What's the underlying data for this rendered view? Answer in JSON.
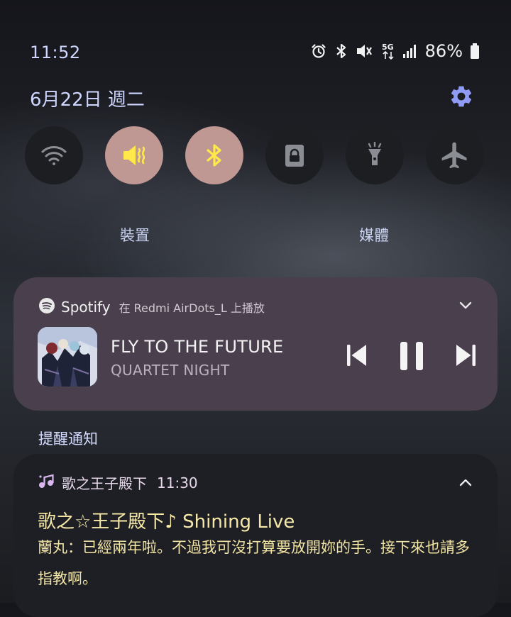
{
  "status_bar": {
    "time": "11:52",
    "battery": "86%",
    "icons": [
      "alarm-icon",
      "bluetooth-icon",
      "mute-icon",
      "5g-data-icon",
      "signal-icon",
      "battery-icon"
    ]
  },
  "header": {
    "date": "6月22日 週二"
  },
  "quick_toggles": [
    {
      "name": "wifi",
      "icon": "wifi-icon",
      "state": "off"
    },
    {
      "name": "sound",
      "icon": "mute-icon",
      "state": "on"
    },
    {
      "name": "bluetooth",
      "icon": "bluetooth-icon",
      "state": "on"
    },
    {
      "name": "screen-lock",
      "icon": "lock-icon",
      "state": "off"
    },
    {
      "name": "flashlight",
      "icon": "flashlight-icon",
      "state": "off"
    },
    {
      "name": "airplane",
      "icon": "airplane-icon",
      "state": "off"
    }
  ],
  "output_buttons": {
    "devices": "裝置",
    "media": "媒體"
  },
  "media": {
    "app_name": "Spotify",
    "device_text": "在 Redmi AirDots_L 上播放",
    "title": "FLY TO THE FUTURE",
    "artist": "QUARTET NIGHT"
  },
  "notifications": {
    "section_title": "提醒通知",
    "items": [
      {
        "app_name": "歌之王子殿下",
        "time": "11:30",
        "title": "歌之☆王子殿下♪ Shining Live",
        "body": "蘭丸：已經兩年啦。不過我可沒打算要放開妳的手。接下來也請多指教啊。"
      }
    ]
  },
  "colors": {
    "accent_periwinkle": "#8f9bf5",
    "toggle_on": "#bf9793",
    "toggle_on_icon": "#ffe84a",
    "media_card": "#4a3f4d",
    "notification_card": "#1e1f24",
    "notification_text": "#f6e9a8"
  }
}
